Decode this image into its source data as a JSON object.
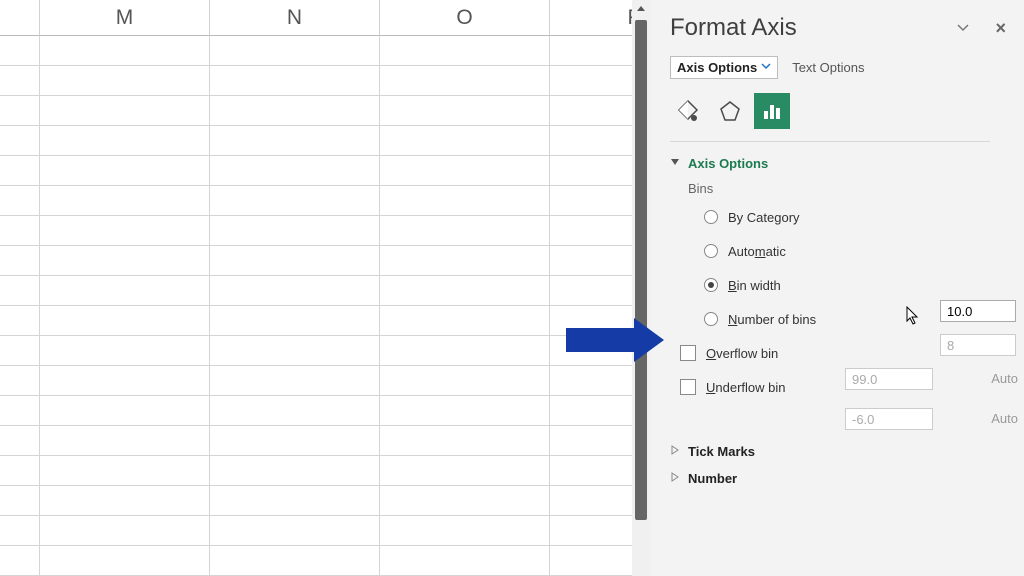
{
  "columns": [
    "M",
    "N",
    "O",
    "P"
  ],
  "pane": {
    "title": "Format Axis",
    "tabs": {
      "axis_options": "Axis Options",
      "text_options": "Text Options"
    }
  },
  "sections": {
    "axis_options": {
      "title": "Axis Options",
      "expanded": true
    },
    "bins_label": "Bins",
    "bins": {
      "by_category": "By Category",
      "automatic": "Automatic",
      "bin_width": "Bin width",
      "number_of_bins": "Number of bins",
      "overflow": "Overflow bin",
      "underflow": "Underflow bin"
    },
    "values": {
      "bin_width": "10.0",
      "number_of_bins": "8",
      "overflow": "99.0",
      "underflow": "-6.0",
      "auto": "Auto"
    },
    "tick_marks": "Tick Marks",
    "number": "Number"
  },
  "underline": {
    "b": "B",
    "m": "m",
    "n": "N",
    "o": "O",
    "u": "U"
  }
}
